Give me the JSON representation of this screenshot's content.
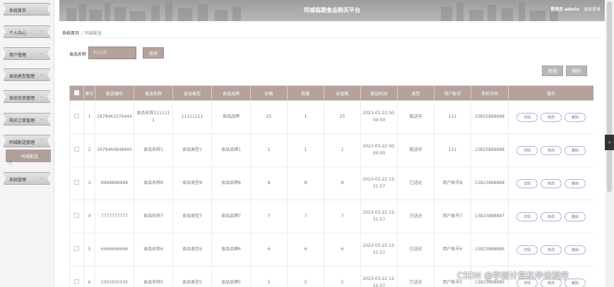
{
  "sidebar": {
    "items": [
      {
        "label": "系统首页",
        "chevron": ""
      },
      {
        "label": "个人中心",
        "chevron": "⌄"
      },
      {
        "label": "用户管理",
        "chevron": "⌄"
      },
      {
        "label": "食品类型管理",
        "chevron": "⌄"
      },
      {
        "label": "食品信息管理",
        "chevron": "⌄"
      },
      {
        "label": "购买订单管理",
        "chevron": "⌄"
      },
      {
        "label": "同城配送管理",
        "chevron": "⌃"
      },
      {
        "label": "系统管理",
        "chevron": "⌄"
      }
    ],
    "sub_item": "同城配送"
  },
  "header": {
    "title": "同城临期食品购买平台",
    "role": "管理员 admin",
    "logout": "退出登录"
  },
  "breadcrumb": {
    "home": "系统首页",
    "current": "同城配送"
  },
  "search": {
    "label": "食品名称",
    "placeholder": "食品名称",
    "query_button": "查询"
  },
  "toolbar": {
    "add_button": "新增",
    "delete_button": "删除"
  },
  "table": {
    "headers": [
      "索引",
      "配送编号",
      "食品名称",
      "食品类型",
      "食品品牌",
      "价格",
      "数量",
      "总金额",
      "配送时间",
      "类型",
      "用户账号",
      "手机号码",
      "操作"
    ],
    "rows": [
      {
        "index": "1",
        "delivery_no": "1679461076444",
        "food_name": "食品名称1111111",
        "food_type": "11111111",
        "brand": "食品品牌",
        "price": "25",
        "qty": "1",
        "total": "25",
        "time": "2023-03-22 00:00:00",
        "status": "配送中",
        "account": "111",
        "phone": "15825888888"
      },
      {
        "index": "2",
        "delivery_no": "1679460848995",
        "food_name": "食品名称1",
        "food_type": "食品类型1",
        "brand": "食品品牌1",
        "price": "1",
        "qty": "1",
        "total": "1",
        "time": "2023-03-22 00:00:00",
        "status": "配送中",
        "account": "111",
        "phone": "15825888888"
      },
      {
        "index": "3",
        "delivery_no": "8888888888",
        "food_name": "食品名称8",
        "food_type": "食品类型8",
        "brand": "食品品牌8",
        "price": "8",
        "qty": "8",
        "total": "8",
        "time": "2023-03-22 12:51:57",
        "status": "已送达",
        "account": "用户账号8",
        "phone": "13823888888"
      },
      {
        "index": "4",
        "delivery_no": "7777777777",
        "food_name": "食品名称7",
        "food_type": "食品类型7",
        "brand": "食品品牌7",
        "price": "7",
        "qty": "7",
        "total": "7",
        "time": "2023-03-22 12:51:57",
        "status": "已送达",
        "account": "用户账号7",
        "phone": "13823888887"
      },
      {
        "index": "5",
        "delivery_no": "6666666666",
        "food_name": "食品名称6",
        "food_type": "食品类型6",
        "brand": "食品品牌6",
        "price": "6",
        "qty": "6",
        "total": "6",
        "time": "2023-03-22 12:51:57",
        "status": "已送达",
        "account": "用户账号6",
        "phone": "13823888886"
      },
      {
        "index": "6",
        "delivery_no": "5555555555",
        "food_name": "食品名称5",
        "food_type": "食品类型5",
        "brand": "食品品牌5",
        "price": "5",
        "qty": "5",
        "total": "5",
        "time": "2023-03-22 12:51:57",
        "status": "已送达",
        "account": "用户账号5",
        "phone": "13823888885"
      }
    ],
    "actions": {
      "detail": "详情",
      "edit": "修改",
      "delete": "删除"
    }
  },
  "watermark": "CSDN @学姐计算机毕设程序",
  "colors": {
    "accent": "#b5a29d",
    "header": "#a9a7a7",
    "op_border": "#b3b0dc"
  }
}
